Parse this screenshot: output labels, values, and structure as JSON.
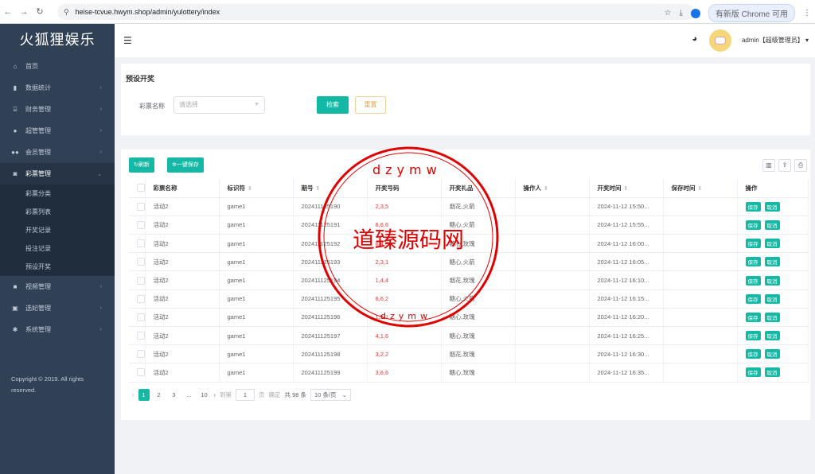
{
  "browser": {
    "url": "heise-tcvue.hwym.shop/admin/yulottery/index",
    "update_label": "有新版 Chrome 可用"
  },
  "sidebar": {
    "brand": "火狐狸娱乐",
    "items": [
      {
        "label": "首页",
        "icon": "home-icon"
      },
      {
        "label": "数据统计",
        "icon": "chart-icon"
      },
      {
        "label": "财务管理",
        "icon": "bank-icon"
      },
      {
        "label": "超管管理",
        "icon": "user-icon"
      },
      {
        "label": "会员管理",
        "icon": "users-icon"
      },
      {
        "label": "彩票管理",
        "icon": "gamepad-icon"
      }
    ],
    "subitems": [
      "彩票分类",
      "彩票列表",
      "开奖记录",
      "投注记录",
      "预设开奖"
    ],
    "items_after": [
      {
        "label": "视频管理",
        "icon": "video-icon"
      },
      {
        "label": "选妃管理",
        "icon": "tag-icon"
      },
      {
        "label": "系统管理",
        "icon": "gear-icon"
      }
    ],
    "copyright": "Copyright © 2019. All rights reserved."
  },
  "header": {
    "username": "admin【超级管理员】"
  },
  "filter": {
    "title": "预设开奖",
    "label": "彩票名称",
    "placeholder": "请选择",
    "search_label": "检索",
    "reset_label": "重置"
  },
  "toolbar": {
    "refresh_label": "刷新",
    "save_all_label": "一键保存"
  },
  "table": {
    "columns": [
      "彩票名称",
      "标识符",
      "期号",
      "开奖号码",
      "开奖礼品",
      "操作人",
      "开奖时间",
      "保存时间",
      "操作"
    ],
    "rows": [
      {
        "name": "活动2",
        "key": "game1",
        "issue": "202411125190",
        "code": "2,3,5",
        "gift": "烟花,火箭",
        "operator": "",
        "time": "2024-11-12 15:50...",
        "saved": ""
      },
      {
        "name": "活动2",
        "key": "game1",
        "issue": "202411125191",
        "code": "6,6,6",
        "gift": "糖心,火箭",
        "operator": "",
        "time": "2024-11-12 15:55...",
        "saved": ""
      },
      {
        "name": "活动2",
        "key": "game1",
        "issue": "202411125192",
        "code": "6,4,3",
        "gift": "糖心,玫瑰",
        "operator": "",
        "time": "2024-11-12 16:00...",
        "saved": ""
      },
      {
        "name": "活动2",
        "key": "game1",
        "issue": "202411125193",
        "code": "2,3,1",
        "gift": "糖心,火箭",
        "operator": "",
        "time": "2024-11-12 16:05...",
        "saved": ""
      },
      {
        "name": "活动2",
        "key": "game1",
        "issue": "202411125194",
        "code": "1,4,4",
        "gift": "烟花,玫瑰",
        "operator": "",
        "time": "2024-11-12 16:10...",
        "saved": ""
      },
      {
        "name": "活动2",
        "key": "game1",
        "issue": "202411125195",
        "code": "6,6,2",
        "gift": "糖心,火箭",
        "operator": "",
        "time": "2024-11-12 16:15...",
        "saved": ""
      },
      {
        "name": "活动2",
        "key": "game1",
        "issue": "202411125196",
        "code": "1,5,1",
        "gift": "糖心,玫瑰",
        "operator": "",
        "time": "2024-11-12 16:20...",
        "saved": ""
      },
      {
        "name": "活动2",
        "key": "game1",
        "issue": "202411125197",
        "code": "4,1,6",
        "gift": "糖心,玫瑰",
        "operator": "",
        "time": "2024-11-12 16:25...",
        "saved": ""
      },
      {
        "name": "活动2",
        "key": "game1",
        "issue": "202411125198",
        "code": "3,2,2",
        "gift": "烟花,玫瑰",
        "operator": "",
        "time": "2024-11-12 16:30...",
        "saved": ""
      },
      {
        "name": "活动2",
        "key": "game1",
        "issue": "202411125199",
        "code": "3,6,6",
        "gift": "糖心,玫瑰",
        "operator": "",
        "time": "2024-11-12 16:35...",
        "saved": ""
      }
    ],
    "save_label": "保存",
    "cancel_label": "取消"
  },
  "pager": {
    "pages": [
      "1",
      "2",
      "3",
      "...",
      "10"
    ],
    "current": "1",
    "goto_label": "到第",
    "page_value": "1",
    "page_unit": "页",
    "confirm_label": "确定",
    "total": "共 98 条",
    "size": "10 条/页"
  },
  "watermark": {
    "text": "道臻源码网",
    "url_top": "dzymw",
    "url_bottom": "dzymw"
  },
  "colors": {
    "sidebar_bg": "#304156",
    "accent": "#13b9a4",
    "stamp": "#e00000"
  }
}
